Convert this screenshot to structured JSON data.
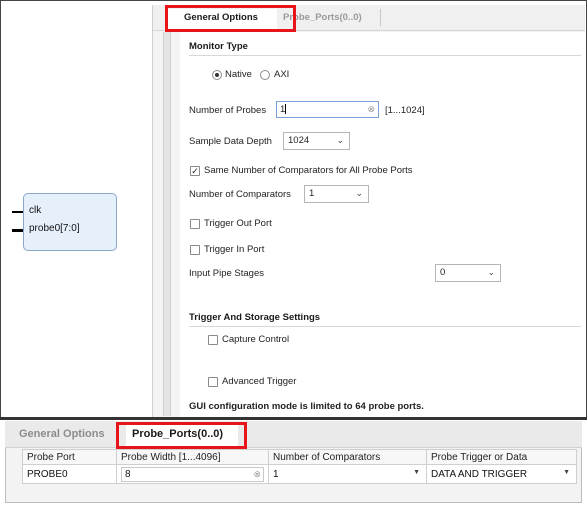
{
  "symbol": {
    "pins": [
      "clk",
      "probe0[7:0]"
    ]
  },
  "options_tabs": {
    "general": "General Options",
    "probe_ports": "Probe_Ports(0..0)"
  },
  "monitor_type": {
    "title": "Monitor Type",
    "native": "Native",
    "axi": "AXI",
    "selected": "Native"
  },
  "num_probes": {
    "label": "Number of Probes",
    "value": "1",
    "range": "[1...1024]"
  },
  "sample_depth": {
    "label": "Sample Data Depth",
    "value": "1024"
  },
  "same_comparators": {
    "label": "Same Number of Comparators for All Probe Ports",
    "checked": true
  },
  "num_comparators": {
    "label": "Number of Comparators",
    "value": "1"
  },
  "trigger_out": {
    "label": "Trigger Out Port",
    "checked": false
  },
  "trigger_in": {
    "label": "Trigger In Port",
    "checked": false
  },
  "input_pipe": {
    "label": "Input Pipe Stages",
    "value": "0"
  },
  "trigger_storage": {
    "title": "Trigger And Storage Settings",
    "capture_control": "Capture Control",
    "advanced_trigger": "Advanced Trigger"
  },
  "gui_note": "GUI configuration mode is limited to 64 probe ports.",
  "bottom_tabs": {
    "general": "General Options",
    "probe_ports": "Probe_Ports(0..0)"
  },
  "probe_table": {
    "headers": [
      "Probe Port",
      "Probe Width [1...4096]",
      "Number of Comparators",
      "Probe Trigger or Data"
    ],
    "rows": [
      [
        "PROBE0",
        "8",
        "1",
        "DATA AND TRIGGER"
      ]
    ]
  },
  "colors": {
    "highlight": "#e8141c",
    "symbol_fill": "#e6f0fb",
    "input_border": "#7aa0d8"
  }
}
